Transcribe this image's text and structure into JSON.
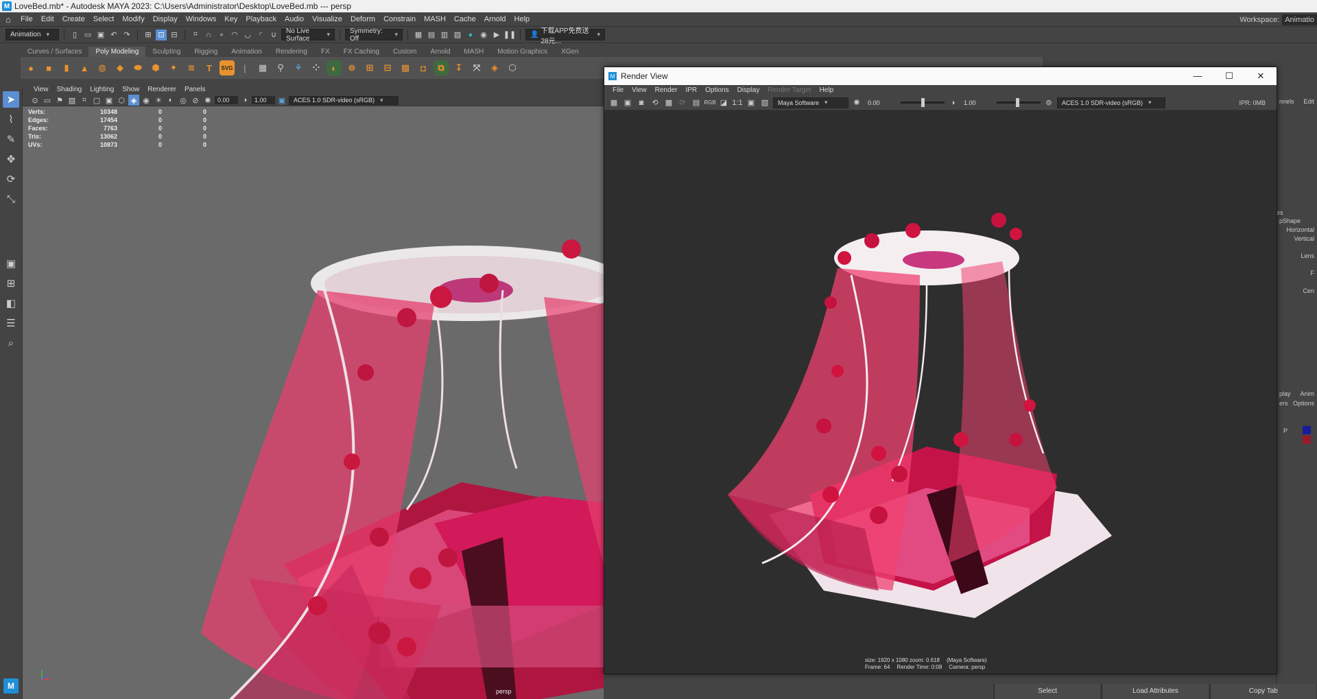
{
  "window": {
    "title": "LoveBed.mb* - Autodesk MAYA 2023: C:\\Users\\Administrator\\Desktop\\LoveBed.mb   ---   persp"
  },
  "menubar": {
    "items": [
      "File",
      "Edit",
      "Create",
      "Select",
      "Modify",
      "Display",
      "Windows",
      "Key",
      "Playback",
      "Audio",
      "Visualize",
      "Deform",
      "Constrain",
      "MASH",
      "Cache",
      "Arnold",
      "Help"
    ],
    "workspace_label": "Workspace:",
    "workspace_value": "Animatio"
  },
  "statusline": {
    "mode": "Animation",
    "live_surface": "No Live Surface",
    "symmetry": "Symmetry: Off",
    "account": "下载APP免费送28元..."
  },
  "shelf": {
    "tabs": [
      "Curves / Surfaces",
      "Poly Modeling",
      "Sculpting",
      "Rigging",
      "Animation",
      "Rendering",
      "FX",
      "FX Caching",
      "Custom",
      "Arnold",
      "MASH",
      "Motion Graphics",
      "XGen"
    ],
    "active_tab": "Poly Modeling"
  },
  "viewport": {
    "menu": [
      "View",
      "Shading",
      "Lighting",
      "Show",
      "Renderer",
      "Panels"
    ],
    "field_a": "0.00",
    "field_b": "1.00",
    "colorspace": "ACES 1.0 SDR-video (sRGB)",
    "camera": "persp",
    "hud": [
      {
        "label": "Verts:",
        "value": "10348",
        "a": "0",
        "b": "0"
      },
      {
        "label": "Edges:",
        "value": "17454",
        "a": "0",
        "b": "0"
      },
      {
        "label": "Faces:",
        "value": "7763",
        "a": "0",
        "b": "0"
      },
      {
        "label": "Tris:",
        "value": "13062",
        "a": "0",
        "b": "0"
      },
      {
        "label": "UVs:",
        "value": "10873",
        "a": "0",
        "b": "0"
      }
    ]
  },
  "render_view": {
    "title": "Render View",
    "menu": [
      "File",
      "View",
      "Render",
      "IPR",
      "Options",
      "Display",
      "Render Target",
      "Help"
    ],
    "renderer": "Maya Software",
    "exposure": "0.00",
    "gamma": "1.00",
    "colorspace": "ACES 1.0 SDR-video (sRGB)",
    "ipr": "IPR: 0MB",
    "one_to_one": "1:1",
    "info_size": "size: 1920 x 1080 zoom: 0.618",
    "info_renderer": "(Maya Software)",
    "info_frame": "Frame: 64",
    "info_time": "Render Time: 0:08",
    "info_camera": "Camera: persp"
  },
  "channelbox": {
    "lines": [
      "nnels",
      "Edit",
      "es",
      "pShape",
      "Horizontal",
      "Vertical",
      "Lens",
      "F",
      "Cen",
      "play",
      "Anim",
      "ers",
      "Options",
      "P"
    ]
  },
  "bottombar": {
    "buttons": [
      "Select",
      "Load Attributes",
      "Copy Tab"
    ]
  }
}
